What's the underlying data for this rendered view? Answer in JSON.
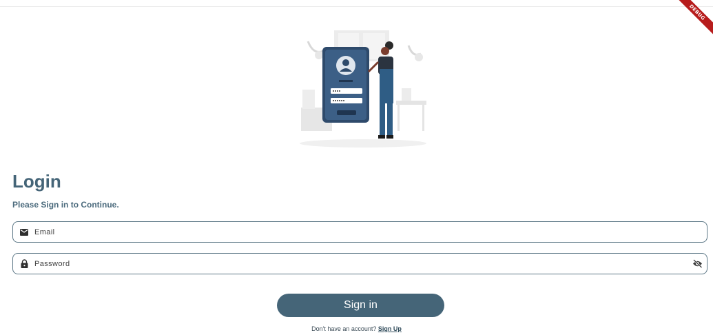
{
  "debug_banner": "DEBUG",
  "login": {
    "title": "Login",
    "subtitle": "Please Sign in to Continue."
  },
  "email_field": {
    "placeholder": "Email",
    "icon": "mail-icon"
  },
  "password_field": {
    "placeholder": "Password",
    "icon": "lock-icon",
    "toggle_icon": "eye-off-icon"
  },
  "signin_button": {
    "label": "Sign in"
  },
  "signup": {
    "prompt": "Don't have an account? ",
    "link": "Sign Up"
  },
  "colors": {
    "primary": "#456578",
    "debug": "#b71c1c",
    "field_border": "#5c7786"
  }
}
